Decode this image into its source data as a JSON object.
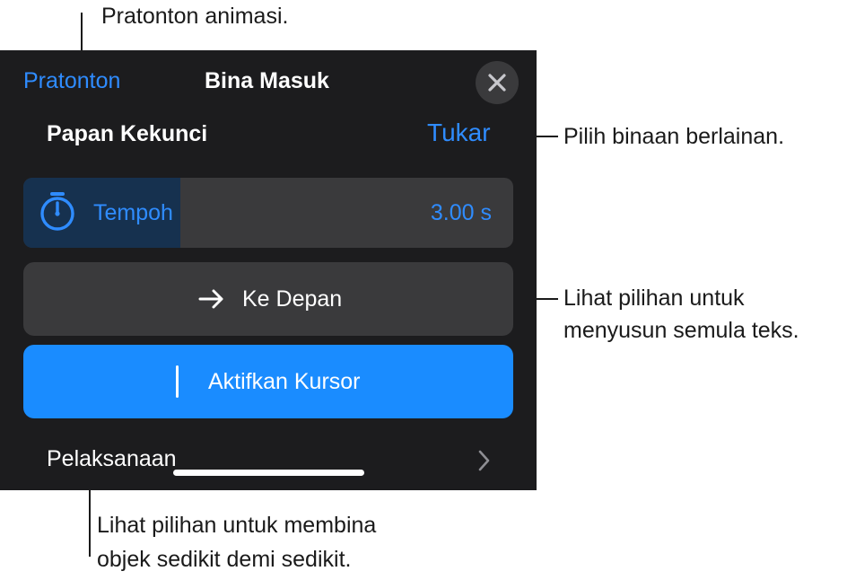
{
  "callouts": {
    "preview": "Pratonton animasi.",
    "change": "Pilih binaan berlainan.",
    "direction_line1": "Lihat pilihan untuk",
    "direction_line2": "menyusun semula teks.",
    "delivery_line1": "Lihat pilihan untuk membina",
    "delivery_line2": "objek sedikit demi sedikit."
  },
  "header": {
    "preview_label": "Pratonton",
    "title": "Bina Masuk"
  },
  "effect": {
    "name": "Papan Kekunci",
    "change_label": "Tukar"
  },
  "duration": {
    "label": "Tempoh",
    "value": "3.00 s",
    "fill_fraction": 0.32
  },
  "direction": {
    "label": "Ke Depan"
  },
  "cursor_button": {
    "label": "Aktifkan Kursor"
  },
  "delivery": {
    "label": "Pelaksanaan"
  },
  "colors": {
    "accent": "#2f8cff",
    "panel_bg": "#1c1c1e",
    "row_bg": "#3a3a3c"
  }
}
